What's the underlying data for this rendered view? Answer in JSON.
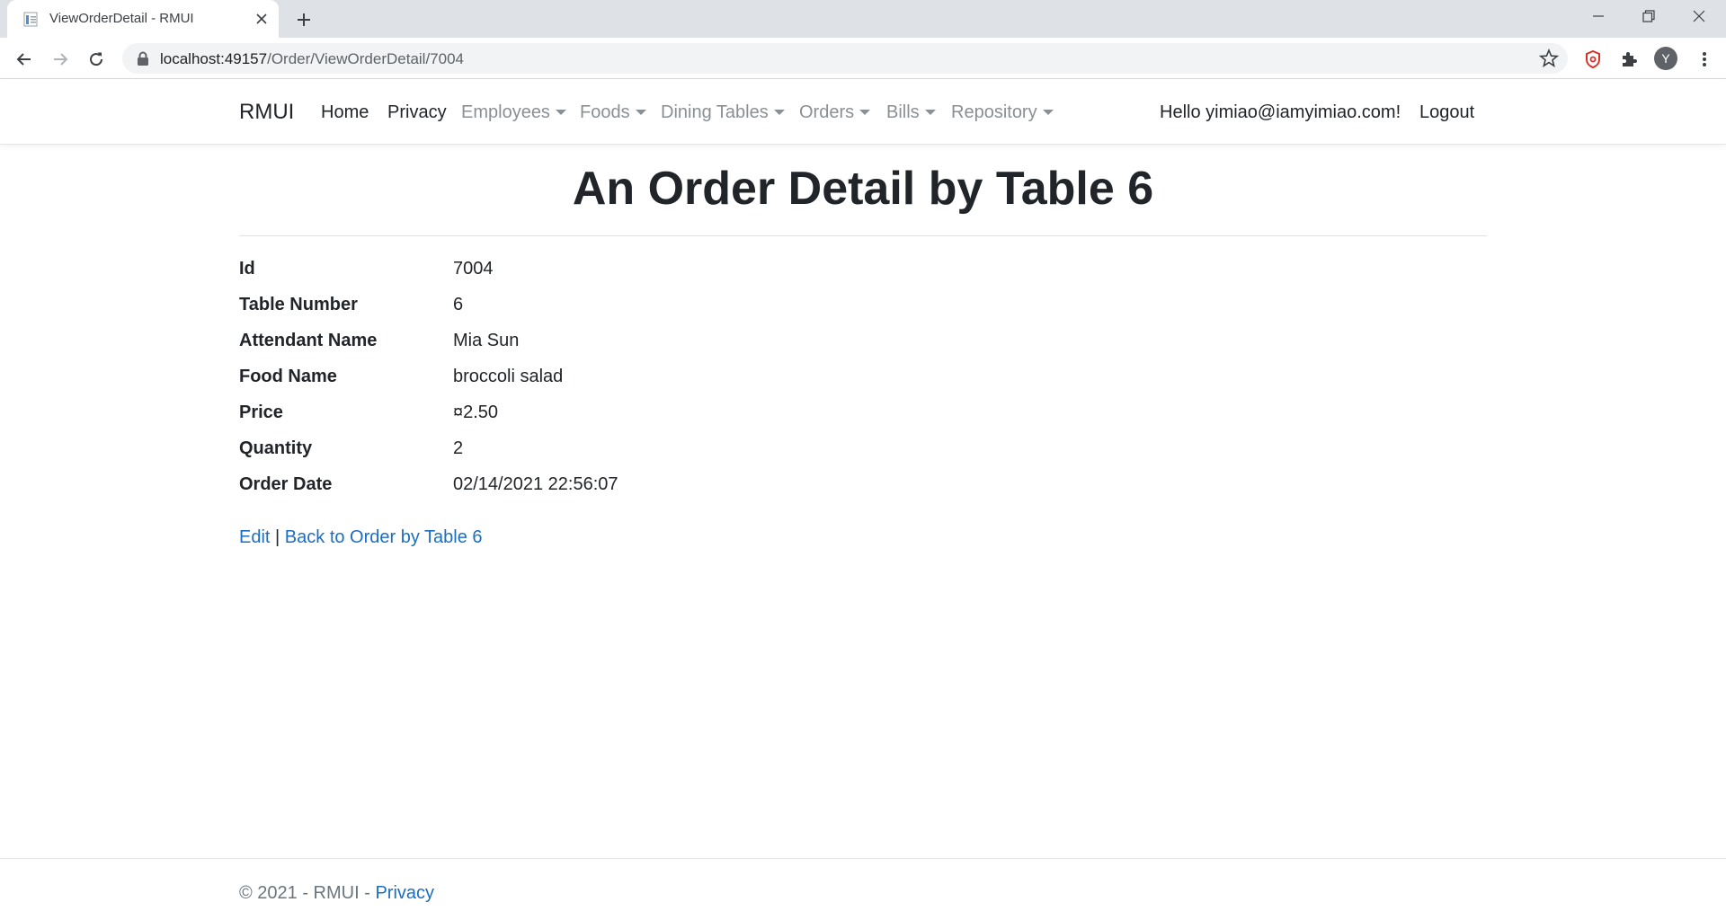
{
  "browser": {
    "tab_title": "ViewOrderDetail - RMUI",
    "url_host": "localhost:49157",
    "url_path": "/Order/ViewOrderDetail/7004",
    "profile_initial": "Y"
  },
  "navbar": {
    "brand": "RMUI",
    "items": [
      {
        "label": "Home",
        "dropdown": false
      },
      {
        "label": "Privacy",
        "dropdown": false
      },
      {
        "label": "Employees",
        "dropdown": true
      },
      {
        "label": "Foods",
        "dropdown": true
      },
      {
        "label": "Dining Tables",
        "dropdown": true
      },
      {
        "label": "Orders",
        "dropdown": true
      },
      {
        "label": "Bills",
        "dropdown": true
      },
      {
        "label": "Repository",
        "dropdown": true
      }
    ],
    "greeting": "Hello yimiao@iamyimiao.com!",
    "logout": "Logout"
  },
  "page": {
    "title": "An Order Detail by Table 6",
    "fields": [
      {
        "term": "Id",
        "value": "7004"
      },
      {
        "term": "Table Number",
        "value": "6"
      },
      {
        "term": "Attendant Name",
        "value": "Mia Sun"
      },
      {
        "term": "Food Name",
        "value": "broccoli salad"
      },
      {
        "term": "Price",
        "value": "¤2.50"
      },
      {
        "term": "Quantity",
        "value": "2"
      },
      {
        "term": "Order Date",
        "value": "02/14/2021 22:56:07"
      }
    ],
    "edit_link": "Edit",
    "separator": "|",
    "back_link": "Back to Order by Table 6"
  },
  "footer": {
    "copyright": "© 2021 - RMUI - ",
    "privacy_link": "Privacy"
  },
  "colors": {
    "link": "#1b6ec2",
    "muted_nav": "#8a8f94",
    "text": "#212529"
  }
}
